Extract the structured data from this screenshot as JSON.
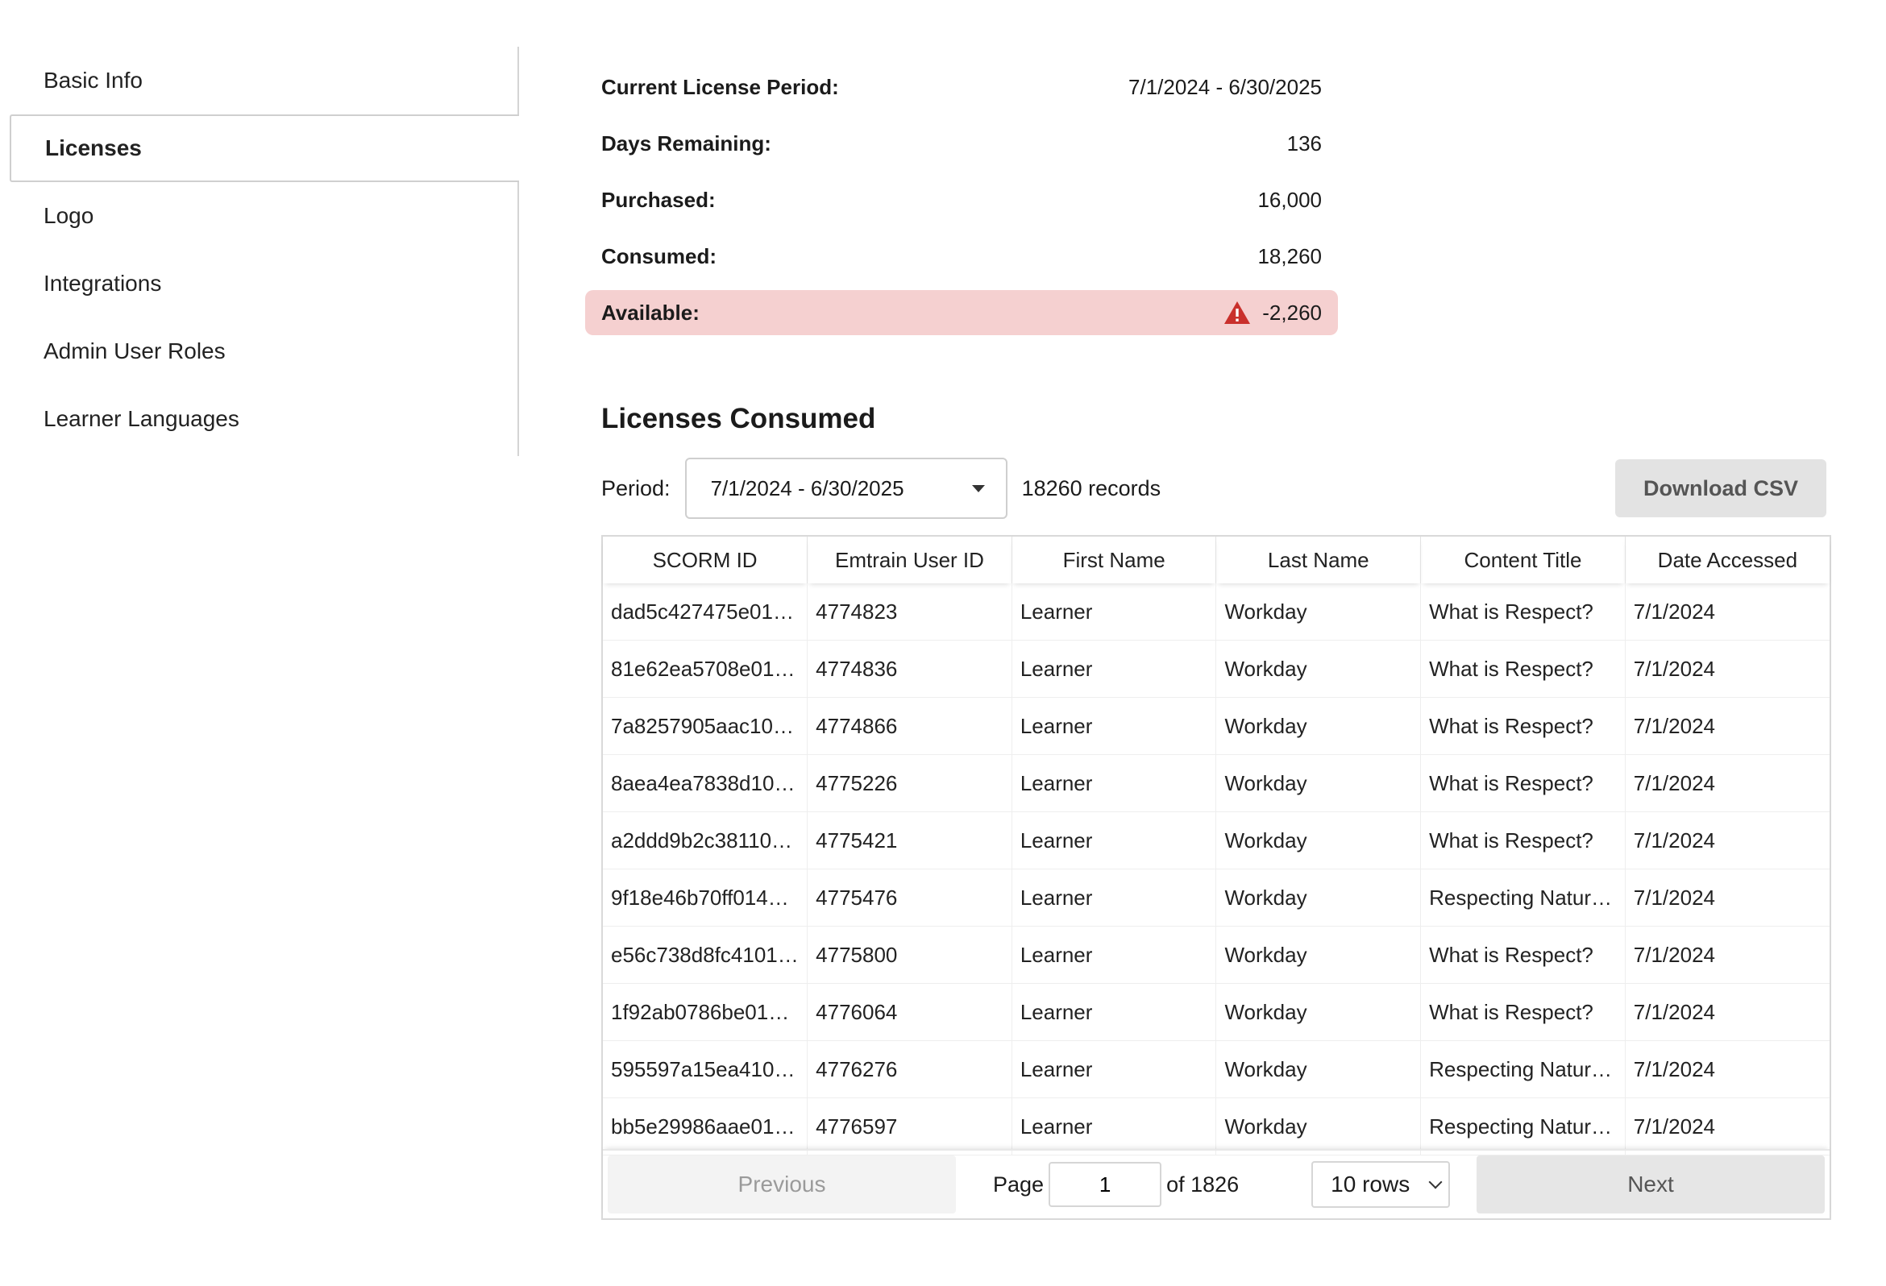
{
  "sidebar": {
    "items": [
      {
        "label": "Basic Info"
      },
      {
        "label": "Licenses",
        "active": true
      },
      {
        "label": "Logo"
      },
      {
        "label": "Integrations"
      },
      {
        "label": "Admin User Roles"
      },
      {
        "label": "Learner Languages"
      }
    ]
  },
  "summary": {
    "period": {
      "label": "Current License Period:",
      "value": "7/1/2024 - 6/30/2025"
    },
    "days": {
      "label": "Days Remaining:",
      "value": "136"
    },
    "purchased": {
      "label": "Purchased:",
      "value": "16,000"
    },
    "consumed": {
      "label": "Consumed:",
      "value": "18,260"
    },
    "available": {
      "label": "Available:",
      "value": "-2,260",
      "icon": "warning-icon",
      "color": "#c9302c",
      "bg": "#f5d0d0"
    }
  },
  "section": {
    "title": "Licenses Consumed",
    "period_label": "Period:",
    "period_value": "7/1/2024 - 6/30/2025",
    "records": "18260 records",
    "download_label": "Download CSV"
  },
  "table": {
    "columns": [
      "SCORM ID",
      "Emtrain User ID",
      "First Name",
      "Last Name",
      "Content Title",
      "Date Accessed"
    ],
    "rows": [
      [
        "dad5c427475e01…",
        "4774823",
        "Learner",
        "Workday",
        "What is Respect?",
        "7/1/2024"
      ],
      [
        "81e62ea5708e01…",
        "4774836",
        "Learner",
        "Workday",
        "What is Respect?",
        "7/1/2024"
      ],
      [
        "7a8257905aac10…",
        "4774866",
        "Learner",
        "Workday",
        "What is Respect?",
        "7/1/2024"
      ],
      [
        "8aea4ea7838d10…",
        "4775226",
        "Learner",
        "Workday",
        "What is Respect?",
        "7/1/2024"
      ],
      [
        "a2ddd9b2c38110…",
        "4775421",
        "Learner",
        "Workday",
        "What is Respect?",
        "7/1/2024"
      ],
      [
        "9f18e46b70ff014…",
        "4775476",
        "Learner",
        "Workday",
        "Respecting Natur…",
        "7/1/2024"
      ],
      [
        "e56c738d8fc4101…",
        "4775800",
        "Learner",
        "Workday",
        "What is Respect?",
        "7/1/2024"
      ],
      [
        "1f92ab0786be01…",
        "4776064",
        "Learner",
        "Workday",
        "What is Respect?",
        "7/1/2024"
      ],
      [
        "595597a15ea410…",
        "4776276",
        "Learner",
        "Workday",
        "Respecting Natur…",
        "7/1/2024"
      ],
      [
        "bb5e29986aae01…",
        "4776597",
        "Learner",
        "Workday",
        "Respecting Natur…",
        "7/1/2024"
      ]
    ]
  },
  "pagination": {
    "previous_label": "Previous",
    "page_label": "Page",
    "page_value": "1",
    "of_label": "of 1826",
    "rows_label": "10 rows",
    "next_label": "Next"
  }
}
